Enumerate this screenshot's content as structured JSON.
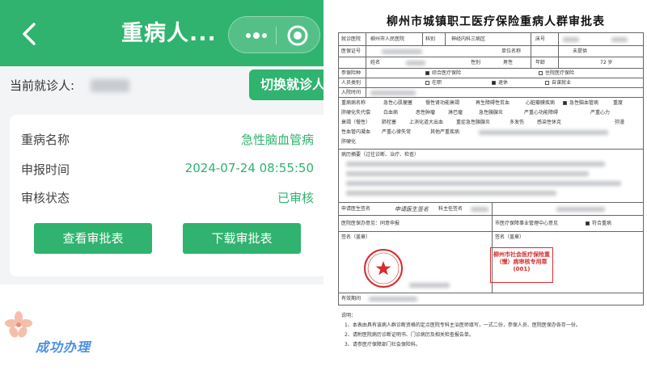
{
  "app": {
    "title": "重病人...",
    "current_patient_label": "当前就诊人:",
    "switch_patient_label": "切换就诊人"
  },
  "detail": {
    "rows": [
      {
        "label": "重病名称",
        "value": "急性脑血管病"
      },
      {
        "label": "申报时间",
        "value": "2024-07-24 08:55:50"
      },
      {
        "label": "审核状态",
        "value": "已审核"
      }
    ],
    "view_button": "查看审批表",
    "download_button": "下载审批表"
  },
  "footer_caption": "成功办理",
  "form": {
    "title": "柳州市城镇职工医疗保险重病人群审批表",
    "hospital_label": "就诊医院",
    "hospital_value": "柳州市人民医院",
    "dept_label": "科别",
    "dept_value": "神经内科三病区",
    "bed_label": "床号",
    "insured_id_label": "医保证号",
    "unit_label": "单位名称",
    "unit_value": "未提供",
    "name_label": "姓名",
    "gender_label": "性别",
    "gender_value": "男性",
    "age_label": "年龄",
    "age_value": "72 岁",
    "insurance_type_label": "参保险种",
    "insurance_opt1": "综合医疗保险",
    "insurance_opt2": "住院医疗保险",
    "person_type_label": "人员类别",
    "person_opt1": "在职",
    "person_opt2": "退休",
    "person_opt3": "自谋就业",
    "admit_date_label": "入院时间",
    "disease_label": "重病病名称",
    "diseases_line1": [
      "急性心肌梗塞",
      "慢性肾功能衰竭",
      "再生障碍性贫血",
      "心脏瓣膜疾病",
      "急性脑血管病",
      "重度"
    ],
    "diseases_line2": [
      "肝硬化失代偿",
      "白血病",
      "恶性肿瘤",
      "淋巴瘤",
      "急性胰腺炎",
      "严重心功能障碍",
      "严重心力"
    ],
    "diseases_line3": [
      "衰竭（慢性）",
      "肺栓塞",
      "上消化道大出血",
      "重症急性胰腺炎",
      "多发伤",
      "感染性休克",
      "弥漫"
    ],
    "diseases_line4": [
      "性血管内凝血",
      "严重心律失常",
      "其他严重疾病"
    ],
    "diseases_line5": [
      "肝硬化"
    ],
    "history_label": "病历摘要（过往诊断、治疗、检查）",
    "applicant_label": "申请医生签名",
    "applicant_sig": "申请医生签名",
    "dept_head_label": "科主任签名",
    "hospital_office_label": "医院医保办意见：同意申报",
    "center_label": "市医疗保障事业管理中心意见",
    "center_opt": "符合重病",
    "sign_label": "签名（盖章）",
    "sign_label2": "签名（盖章）",
    "stamp_text": "柳州市社会医疗保险重（慢）病审核专用章(001)",
    "valid_label": "有效期间",
    "notes_title": "说明：",
    "notes": [
      "1、本表由具有该病人群诊断资格的定点医院专科主治医师填写，一式二份，参保人员、医院医保办各存一份。",
      "2、请附医院病历诊断证明书、门诊病历及相关检查报告单。",
      "3、请参医疗保障部门社会保险科。"
    ]
  },
  "colors": {
    "primary": "#2fb36e",
    "page_bg": "#f2f4f5",
    "caption": "#4a90e2",
    "stamp_red": "#d62c2c"
  }
}
